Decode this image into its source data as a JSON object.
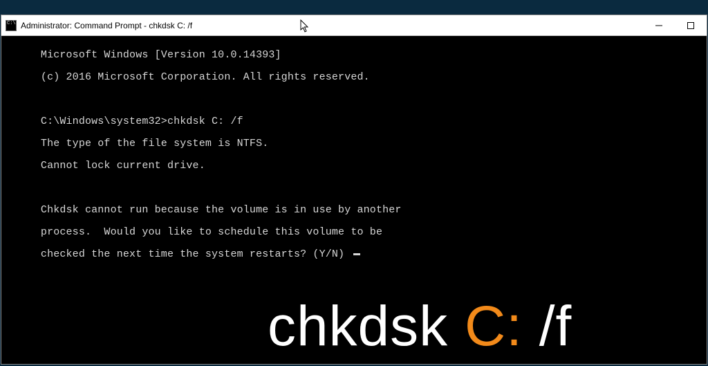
{
  "window": {
    "title": "Administrator: Command Prompt - chkdsk  C: /f"
  },
  "controls": {
    "minimize_name": "minimize-button",
    "maximize_name": "maximize-button",
    "close_name": "close-button"
  },
  "terminal": {
    "line_version": "Microsoft Windows [Version 10.0.14393]",
    "line_copyright": "(c) 2016 Microsoft Corporation. All rights reserved.",
    "blank1": "",
    "prompt_line": "C:\\Windows\\system32>chkdsk C: /f",
    "line_fs_type": "The type of the file system is NTFS.",
    "line_lock": "Cannot lock current drive.",
    "blank2": "",
    "msg_line1": "Chkdsk cannot run because the volume is in use by another",
    "msg_line2": "process.  Would you like to schedule this volume to be",
    "msg_line3": "checked the next time the system restarts? (Y/N) "
  },
  "caption": {
    "part1": "chkdsk ",
    "part2_accent": "C:",
    "part3": " /f"
  },
  "colors": {
    "accent": "#f28a1a"
  }
}
